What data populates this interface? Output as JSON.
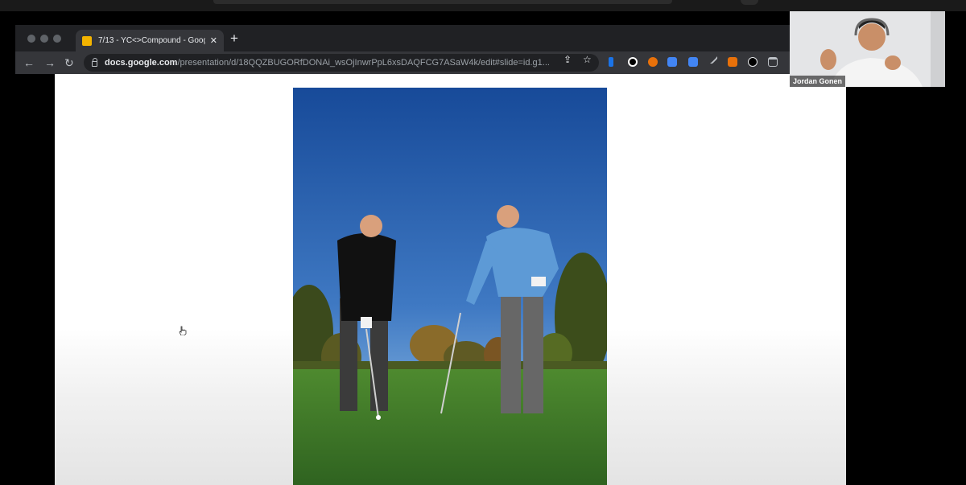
{
  "tab": {
    "title": "7/13 - YC<>Compound - Goog",
    "close": "✕",
    "new_tab": "+"
  },
  "toolbar": {
    "back": "←",
    "forward": "→",
    "reload": "↻",
    "url_host": "docs.google.com",
    "url_path": "/presentation/d/18QQZBUGORfDONAi_wsOjInwrPpL6xsDAQFCG7ASaW4k/edit#slide=id.g1...",
    "share_icon": "⇪",
    "bookmark_icon": "☆"
  },
  "extensions": [
    "bolt-icon",
    "circle-arrow-icon",
    "bell-icon",
    "comment-icon",
    "mail-icon",
    "pen-icon",
    "orange-square-icon",
    "password-icon",
    "trash-icon"
  ],
  "participant": {
    "name": "Jordan Gonen"
  },
  "slide": {
    "image": "two golfers on green fairway under blue sky"
  },
  "colors": {
    "chrome_dark": "#202124",
    "chrome_toolbar": "#35363a",
    "sky": "#2a5fa8",
    "grass": "#3d7a2a"
  }
}
